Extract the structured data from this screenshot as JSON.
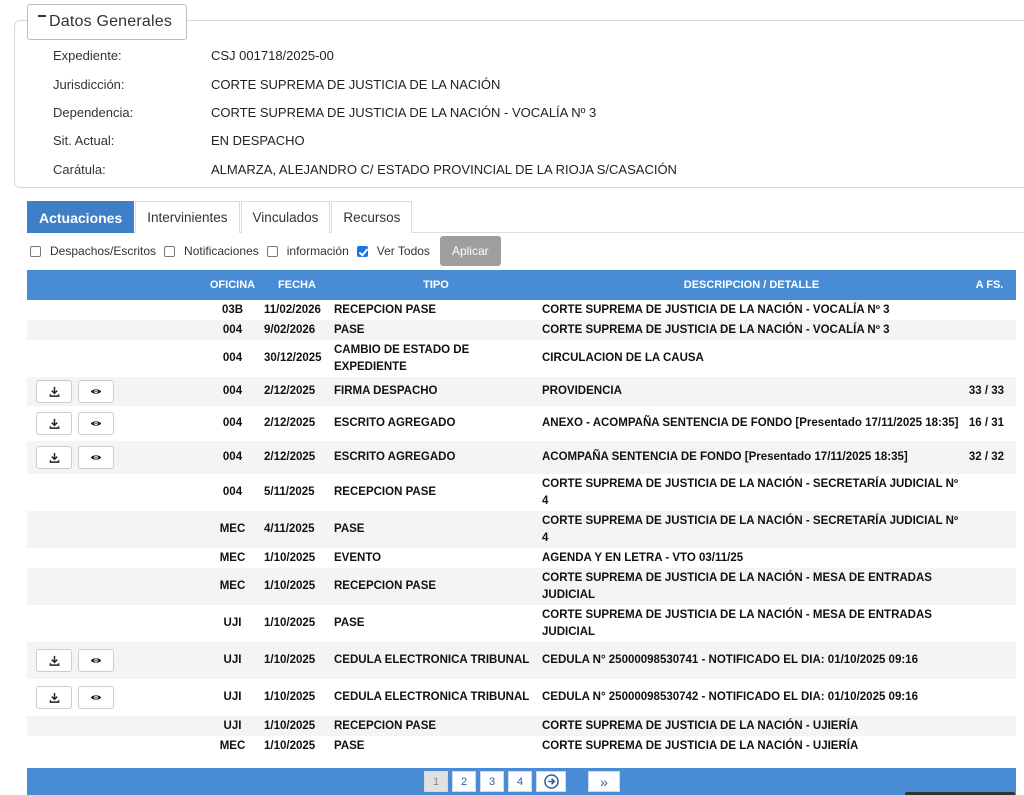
{
  "section": {
    "title": "Datos Generales",
    "fields": [
      {
        "label": "Expediente:",
        "value": "CSJ 001718/2025-00"
      },
      {
        "label": "Jurisdicción:",
        "value": "CORTE SUPREMA DE JUSTICIA DE LA NACIÓN"
      },
      {
        "label": "Dependencia:",
        "value": "CORTE SUPREMA DE JUSTICIA DE LA NACIÓN - VOCALÍA Nº 3"
      },
      {
        "label": "Sit. Actual:",
        "value": "EN DESPACHO"
      },
      {
        "label": "Carátula:",
        "value": "ALMARZA, ALEJANDRO C/ ESTADO PROVINCIAL DE LA RIOJA S/CASACIÓN"
      }
    ]
  },
  "tabs": [
    "Actuaciones",
    "Intervinientes",
    "Vinculados",
    "Recursos"
  ],
  "filters": {
    "items": [
      {
        "label": "Despachos/Escritos",
        "checked": false
      },
      {
        "label": "Notificaciones",
        "checked": false
      },
      {
        "label": "información",
        "checked": false
      },
      {
        "label": "Ver Todos",
        "checked": true
      }
    ],
    "apply_label": "Aplicar"
  },
  "table": {
    "headers": [
      "",
      "OFICINA",
      "FECHA",
      "TIPO",
      "DESCRIPCION / DETALLE",
      "A FS."
    ],
    "rows": [
      {
        "actions": false,
        "oficina": "03B",
        "fecha": "11/02/2026",
        "tipo": "RECEPCION PASE",
        "desc": "CORTE SUPREMA DE JUSTICIA DE LA NACIÓN - VOCALÍA Nº 3",
        "afs": ""
      },
      {
        "actions": false,
        "oficina": "004",
        "fecha": "9/02/2026",
        "tipo": "PASE",
        "desc": "CORTE SUPREMA DE JUSTICIA DE LA NACIÓN - VOCALÍA Nº 3",
        "afs": ""
      },
      {
        "actions": false,
        "oficina": "004",
        "fecha": "30/12/2025",
        "tipo": "CAMBIO DE ESTADO DE EXPEDIENTE",
        "desc": "CIRCULACION DE LA CAUSA",
        "afs": ""
      },
      {
        "actions": true,
        "oficina": "004",
        "fecha": "2/12/2025",
        "tipo": "FIRMA DESPACHO",
        "desc": "PROVIDENCIA",
        "afs": "33 / 33"
      },
      {
        "actions": true,
        "oficina": "004",
        "fecha": "2/12/2025",
        "tipo": "ESCRITO AGREGADO",
        "desc": "ANEXO - ACOMPAÑA SENTENCIA DE FONDO [Presentado 17/11/2025 18:35]",
        "afs": "16 / 31"
      },
      {
        "actions": true,
        "oficina": "004",
        "fecha": "2/12/2025",
        "tipo": "ESCRITO AGREGADO",
        "desc": "ACOMPAÑA SENTENCIA DE FONDO [Presentado 17/11/2025 18:35]",
        "afs": "32 / 32"
      },
      {
        "actions": false,
        "oficina": "004",
        "fecha": "5/11/2025",
        "tipo": "RECEPCION PASE",
        "desc": "CORTE SUPREMA DE JUSTICIA DE LA NACIÓN - SECRETARÍA JUDICIAL Nº 4",
        "afs": ""
      },
      {
        "actions": false,
        "oficina": "MEC",
        "fecha": "4/11/2025",
        "tipo": "PASE",
        "desc": "CORTE SUPREMA DE JUSTICIA DE LA NACIÓN - SECRETARÍA JUDICIAL Nº 4",
        "afs": ""
      },
      {
        "actions": false,
        "oficina": "MEC",
        "fecha": "1/10/2025",
        "tipo": "EVENTO",
        "desc": "AGENDA Y EN LETRA - VTO 03/11/25",
        "afs": ""
      },
      {
        "actions": false,
        "oficina": "MEC",
        "fecha": "1/10/2025",
        "tipo": "RECEPCION PASE",
        "desc": "CORTE SUPREMA DE JUSTICIA DE LA NACIÓN - MESA DE ENTRADAS JUDICIAL",
        "afs": ""
      },
      {
        "actions": false,
        "oficina": "UJI",
        "fecha": "1/10/2025",
        "tipo": "PASE",
        "desc": "CORTE SUPREMA DE JUSTICIA DE LA NACIÓN - MESA DE ENTRADAS JUDICIAL",
        "afs": ""
      },
      {
        "actions": true,
        "oficina": "UJI",
        "fecha": "1/10/2025",
        "tipo": "CEDULA ELECTRONICA TRIBUNAL",
        "desc": "CEDULA N° 25000098530741 - NOTIFICADO EL DIA: 01/10/2025 09:16",
        "afs": ""
      },
      {
        "actions": true,
        "oficina": "UJI",
        "fecha": "1/10/2025",
        "tipo": "CEDULA ELECTRONICA TRIBUNAL",
        "desc": "CEDULA N° 25000098530742 - NOTIFICADO EL DIA: 01/10/2025 09:16",
        "afs": ""
      },
      {
        "actions": false,
        "oficina": "UJI",
        "fecha": "1/10/2025",
        "tipo": "RECEPCION PASE",
        "desc": "CORTE SUPREMA DE JUSTICIA DE LA NACIÓN - UJIERÍA",
        "afs": ""
      },
      {
        "actions": false,
        "oficina": "MEC",
        "fecha": "1/10/2025",
        "tipo": "PASE",
        "desc": "CORTE SUPREMA DE JUSTICIA DE LA NACIÓN - UJIERÍA",
        "afs": ""
      }
    ]
  },
  "pagination": {
    "pages": [
      "1",
      "2",
      "3",
      "4"
    ],
    "current": "1",
    "next_icon": "circle-arrow-right-icon",
    "last_label": "»"
  },
  "icons": {
    "download": "download-icon",
    "view": "eye-icon"
  },
  "colors": {
    "accent": "#4a8bd6",
    "active_tab": "#3f7fc8",
    "apply_button": "#9e9e9e"
  }
}
